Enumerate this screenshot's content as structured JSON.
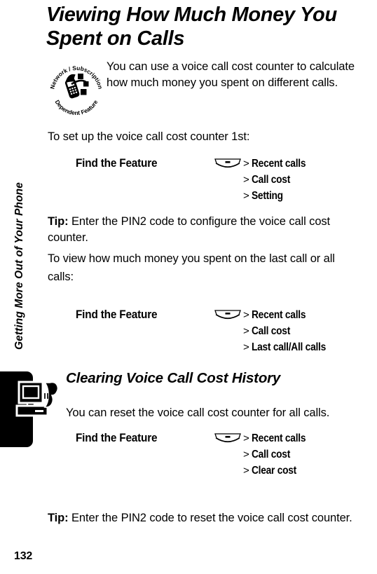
{
  "page": {
    "number": "132",
    "chapter_rail_label": "Getting More Out of Your Phone",
    "chapter_tab_icon": "computer-phone-icon"
  },
  "title": "Viewing How Much Money You Spent on Calls",
  "badge": {
    "icon_name": "network-subscription-dependent-feature-badge",
    "ring_top_text": "Network / Subscription",
    "ring_bottom_text": "Dependent Feature",
    "paragraph": "You can use a voice call cost counter to calculate how much money you spent on different calls."
  },
  "intro_line": "To set up the voice call cost counter 1st:",
  "find_feature_1": {
    "label": "Find the Feature",
    "key_icon": "menu-soft-key-icon",
    "items": [
      {
        "chevron": ">",
        "label": "Recent calls"
      },
      {
        "chevron": ">",
        "label": "Call cost"
      },
      {
        "chevron": ">",
        "label": "Setting"
      }
    ]
  },
  "tip_1": {
    "prefix": "Tip:",
    "text": " Enter the PIN2 code to configure the voice call cost counter."
  },
  "view_line_a": "To view how much money you spent on the last call or all",
  "view_line_b": "calls:",
  "find_feature_2": {
    "label": "Find the Feature",
    "key_icon": "menu-soft-key-icon",
    "items": [
      {
        "chevron": ">",
        "label": "Recent calls"
      },
      {
        "chevron": ">",
        "label": "Call cost"
      },
      {
        "chevron": ">",
        "label": "Last call/All calls"
      }
    ]
  },
  "section": {
    "heading": "Clearing Voice Call Cost History",
    "paragraph": "You can reset the voice call cost counter for all calls."
  },
  "find_feature_3": {
    "label": "Find the Feature",
    "key_icon": "menu-soft-key-icon",
    "items": [
      {
        "chevron": ">",
        "label": "Recent calls"
      },
      {
        "chevron": ">",
        "label": "Call cost"
      },
      {
        "chevron": ">",
        "label": "Clear cost"
      }
    ]
  },
  "tip_2": {
    "prefix": "Tip:",
    "text": " Enter the PIN2 code to reset the voice call cost counter."
  },
  "colors": {
    "ink": "#000000",
    "paper": "#ffffff"
  }
}
